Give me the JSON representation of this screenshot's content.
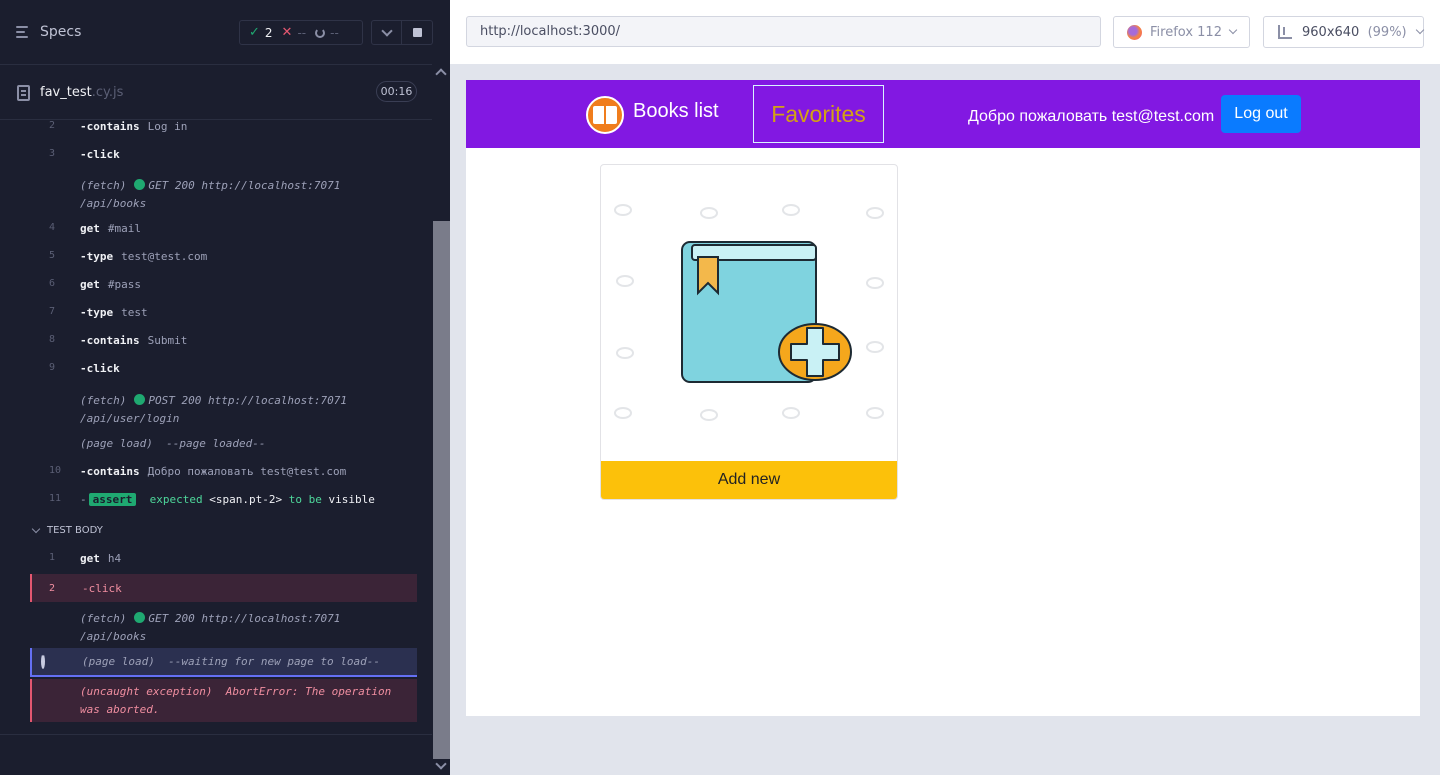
{
  "reporter": {
    "specs_label": "Specs",
    "stats": {
      "passed": "2",
      "failed": "--",
      "pending": "--"
    },
    "spec_file": {
      "name": "fav_test",
      "ext": ".cy.js",
      "duration": "00:16"
    },
    "commands": [
      {
        "num": "2",
        "name": "-contains",
        "arg": "Log in"
      },
      {
        "num": "3",
        "name": "-click",
        "arg": ""
      },
      {
        "log_type": "(fetch)",
        "line1": "GET 200 http://localhost:7071",
        "line2": "/api/books"
      },
      {
        "num": "4",
        "name": "get",
        "arg": "#mail"
      },
      {
        "num": "5",
        "name": "-type",
        "arg": "test@test.com"
      },
      {
        "num": "6",
        "name": "get",
        "arg": "#pass"
      },
      {
        "num": "7",
        "name": "-type",
        "arg": "test"
      },
      {
        "num": "8",
        "name": "-contains",
        "arg": "Submit"
      },
      {
        "num": "9",
        "name": "-click",
        "arg": ""
      },
      {
        "log_type": "(fetch)",
        "line1": "POST 200 http://localhost:7071",
        "line2": "/api/user/login"
      },
      {
        "log_type": "(page load)",
        "line1": "--page loaded--"
      },
      {
        "num": "10",
        "name": "-contains",
        "arg": "Добро пожаловать test@test.com"
      },
      {
        "num": "11",
        "assert_word": "assert",
        "expected": "expected",
        "subject": "<span.pt-2>",
        "to_be": "to be",
        "state": "visible"
      }
    ],
    "section_title": "TEST BODY",
    "body_commands": [
      {
        "num": "1",
        "name": "get",
        "arg": "h4"
      },
      {
        "num": "2",
        "name": "-click",
        "arg": ""
      },
      {
        "log_type": "(fetch)",
        "line1": "GET 200 http://localhost:7071",
        "line2": "/api/books"
      },
      {
        "log_type": "(page load)",
        "line1": "--waiting for new page to load--"
      },
      {
        "log_type": "(uncaught exception)",
        "line1": "AbortError: The operation",
        "line2": "was aborted."
      }
    ]
  },
  "browser": {
    "url": "http://localhost:3000/",
    "browser_name": "Firefox 112",
    "viewport": "960x640",
    "zoom": "(99%)"
  },
  "app": {
    "brand": "Books list",
    "favorites": "Favorites",
    "welcome": "Добро пожаловать test@test.com",
    "logout": "Log out",
    "card_button": "Add new"
  },
  "colors": {
    "navbar": "#8218e2",
    "logout_button": "#0a7bff",
    "add_button": "#fcc10a",
    "pass": "#1fa971",
    "fail": "#e45770"
  }
}
